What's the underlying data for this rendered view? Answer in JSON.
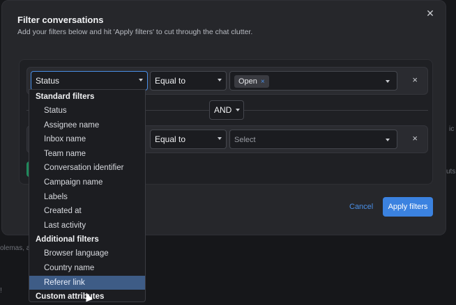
{
  "background": {
    "text_left": "olemas, ap",
    "text_right_1": "ic",
    "text_right_2": "uts",
    "text_bottom": "!"
  },
  "modal": {
    "title": "Filter conversations",
    "subtitle": "Add your filters below and hit 'Apply filters' to cut through the chat clutter.",
    "close_icon": "close-icon"
  },
  "filters": [
    {
      "attribute": "Status",
      "operator": "Equal to",
      "value_tag": "Open",
      "value_tag_remove": "×"
    },
    {
      "attribute": "",
      "operator": "Equal to",
      "value_placeholder": "Select"
    }
  ],
  "row_remove_label": "×",
  "and_label": "AND",
  "footer": {
    "cancel_label": "Cancel",
    "apply_label": "Apply filters"
  },
  "dropdown": {
    "standard_header": "Standard filters",
    "standard_items": [
      "Status",
      "Assignee name",
      "Inbox name",
      "Team name",
      "Conversation identifier",
      "Campaign name",
      "Labels",
      "Created at",
      "Last activity"
    ],
    "additional_header": "Additional filters",
    "additional_items": [
      "Browser language",
      "Country name",
      "Referer link"
    ],
    "custom_header": "Custom attributes",
    "active_item": "Referer link"
  },
  "colors": {
    "accent": "#3b82e0",
    "modal_bg": "#26272b",
    "page_bg": "#16171a",
    "active_item_bg": "#3e5c86",
    "green": "#1f8a5c"
  }
}
